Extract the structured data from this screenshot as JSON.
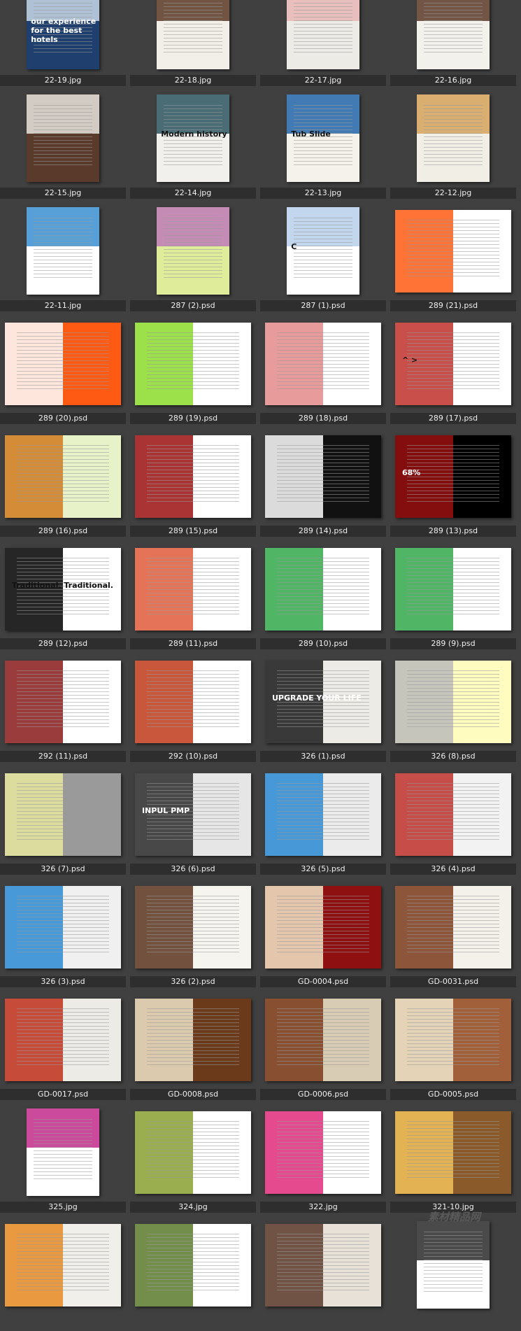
{
  "app": {
    "watermark": "素材精品网"
  },
  "thumbnails": [
    {
      "filename": "22-19.jpg",
      "orientation": "portrait",
      "bg": "#1f3f6e",
      "accent": "#c8d8e8",
      "text": "our experience for the best hotels"
    },
    {
      "filename": "22-18.jpg",
      "orientation": "portrait",
      "bg": "#f2efe8",
      "accent": "#5a3a24",
      "text": ""
    },
    {
      "filename": "22-17.jpg",
      "orientation": "portrait",
      "bg": "#ecebe6",
      "accent": "#e7b7b5",
      "text": ""
    },
    {
      "filename": "22-16.jpg",
      "orientation": "portrait",
      "bg": "#f3f1ec",
      "accent": "#5a3a28",
      "text": ""
    },
    {
      "filename": "22-15.jpg",
      "orientation": "portrait",
      "bg": "#5a3a2a",
      "accent": "#e9e6df",
      "text": ""
    },
    {
      "filename": "22-14.jpg",
      "orientation": "portrait",
      "bg": "#f1f0ec",
      "accent": "#2d5660",
      "text": "Modern history"
    },
    {
      "filename": "22-13.jpg",
      "orientation": "portrait",
      "bg": "#f4f2ea",
      "accent": "#2266aa",
      "text": "Tub Slide"
    },
    {
      "filename": "22-12.jpg",
      "orientation": "portrait",
      "bg": "#f1eee6",
      "accent": "#d6a25a",
      "text": ""
    },
    {
      "filename": "22-11.jpg",
      "orientation": "portrait",
      "bg": "#ffffff",
      "accent": "#3a8fd0",
      "text": ""
    },
    {
      "filename": "287 (2).psd",
      "orientation": "portrait",
      "bg": "#dfed9a",
      "accent": "#c07ab8",
      "text": ""
    },
    {
      "filename": "287 (1).psd",
      "orientation": "portrait",
      "bg": "#ffffff",
      "accent": "#b7d0ea",
      "text": "C"
    },
    {
      "filename": "289 (21).psd",
      "orientation": "landscape",
      "bg": "#ffffff",
      "accent": "#ff5a14",
      "text": ""
    },
    {
      "filename": "289 (20).psd",
      "orientation": "landscape",
      "bg": "#ff5a14",
      "accent": "#ffffff",
      "text": ""
    },
    {
      "filename": "289 (19).psd",
      "orientation": "landscape",
      "bg": "#ffffff",
      "accent": "#8bdc2a",
      "text": ""
    },
    {
      "filename": "289 (18).psd",
      "orientation": "landscape",
      "bg": "#ffffff",
      "accent": "#e48a8a",
      "text": ""
    },
    {
      "filename": "289 (17).psd",
      "orientation": "landscape",
      "bg": "#ffffff",
      "accent": "#c0302a",
      "text": "^  >"
    },
    {
      "filename": "289 (16).psd",
      "orientation": "landscape",
      "bg": "#e8f2c8",
      "accent": "#d07a1c",
      "text": ""
    },
    {
      "filename": "289 (15).psd",
      "orientation": "landscape",
      "bg": "#ffffff",
      "accent": "#9b1111",
      "text": ""
    },
    {
      "filename": "289 (14).psd",
      "orientation": "landscape",
      "bg": "#111111",
      "accent": "#ffffff",
      "text": ""
    },
    {
      "filename": "289 (13).psd",
      "orientation": "landscape",
      "bg": "#000000",
      "accent": "#9b1111",
      "text": "68%"
    },
    {
      "filename": "289 (12).psd",
      "orientation": "landscape",
      "bg": "#ffffff",
      "accent": "#000000",
      "text": "Traditional. Traditional."
    },
    {
      "filename": "289 (11).psd",
      "orientation": "landscape",
      "bg": "#ffffff",
      "accent": "#e15a3b",
      "text": ""
    },
    {
      "filename": "289 (10).psd",
      "orientation": "landscape",
      "bg": "#ffffff",
      "accent": "#31a84a",
      "text": ""
    },
    {
      "filename": "289 (9).psd",
      "orientation": "landscape",
      "bg": "#ffffff",
      "accent": "#31a84a",
      "text": ""
    },
    {
      "filename": "292 (11).psd",
      "orientation": "landscape",
      "bg": "#ffffff",
      "accent": "#8a1a1a",
      "text": ""
    },
    {
      "filename": "292 (10).psd",
      "orientation": "landscape",
      "bg": "#ffffff",
      "accent": "#c03a1a",
      "text": ""
    },
    {
      "filename": "326 (1).psd",
      "orientation": "landscape",
      "bg": "#ecebe6",
      "accent": "#1a1a1a",
      "text": "UPGRADE YOUR LIFE"
    },
    {
      "filename": "326 (8).psd",
      "orientation": "landscape",
      "bg": "#fffcc0",
      "accent": "#bbbbbb",
      "text": ""
    },
    {
      "filename": "326 (7).psd",
      "orientation": "landscape",
      "bg": "#9a9a9a",
      "accent": "#e8e8a0",
      "text": ""
    },
    {
      "filename": "326 (6).psd",
      "orientation": "landscape",
      "bg": "#e6e6e6",
      "accent": "#2c2c2c",
      "text": "INPUL PMP"
    },
    {
      "filename": "326 (5).psd",
      "orientation": "landscape",
      "bg": "#ebebeb",
      "accent": "#2a8ad4",
      "text": ""
    },
    {
      "filename": "326 (4).psd",
      "orientation": "landscape",
      "bg": "#f2f2f2",
      "accent": "#c0302a",
      "text": ""
    },
    {
      "filename": "326 (3).psd",
      "orientation": "landscape",
      "bg": "#f0f0f0",
      "accent": "#2a8ad4",
      "text": ""
    },
    {
      "filename": "326 (2).psd",
      "orientation": "landscape",
      "bg": "#f6f4ef",
      "accent": "#5a3420",
      "text": ""
    },
    {
      "filename": "GD-0004.psd",
      "orientation": "landscape",
      "bg": "#8e1010",
      "accent": "#f3e6c8",
      "text": ""
    },
    {
      "filename": "GD-0031.psd",
      "orientation": "landscape",
      "bg": "#f4f1ea",
      "accent": "#7a3a1a",
      "text": ""
    },
    {
      "filename": "GD-0017.psd",
      "orientation": "landscape",
      "bg": "#ecebe6",
      "accent": "#c0301a",
      "text": ""
    },
    {
      "filename": "GD-0008.psd",
      "orientation": "landscape",
      "bg": "#6a3a1a",
      "accent": "#efe4c8",
      "text": ""
    },
    {
      "filename": "GD-0006.psd",
      "orientation": "landscape",
      "bg": "#d8ccb4",
      "accent": "#7a3a1a",
      "text": ""
    },
    {
      "filename": "GD-0005.psd",
      "orientation": "landscape",
      "bg": "#a2603a",
      "accent": "#f1e7cf",
      "text": ""
    },
    {
      "filename": "325.jpg",
      "orientation": "portrait",
      "bg": "#ffffff",
      "accent": "#c22a8a",
      "text": ""
    },
    {
      "filename": "324.jpg",
      "orientation": "landscape",
      "bg": "#ffffff",
      "accent": "#8aa030",
      "text": ""
    },
    {
      "filename": "322.jpg",
      "orientation": "landscape",
      "bg": "#ffffff",
      "accent": "#e0297a",
      "text": ""
    },
    {
      "filename": "321-10.jpg",
      "orientation": "landscape",
      "bg": "#8a5a2a",
      "accent": "#f2c35a",
      "text": ""
    },
    {
      "filename": "",
      "orientation": "landscape",
      "bg": "#f1efea",
      "accent": "#e88a22",
      "text": ""
    },
    {
      "filename": "",
      "orientation": "landscape",
      "bg": "#ffffff",
      "accent": "#5a7a2a",
      "text": ""
    },
    {
      "filename": "",
      "orientation": "landscape",
      "bg": "#e8e1d8",
      "accent": "#5a3a2a",
      "text": ""
    },
    {
      "filename": "",
      "orientation": "portrait",
      "bg": "#ffffff",
      "accent": "#2a2a2a",
      "text": ""
    }
  ]
}
